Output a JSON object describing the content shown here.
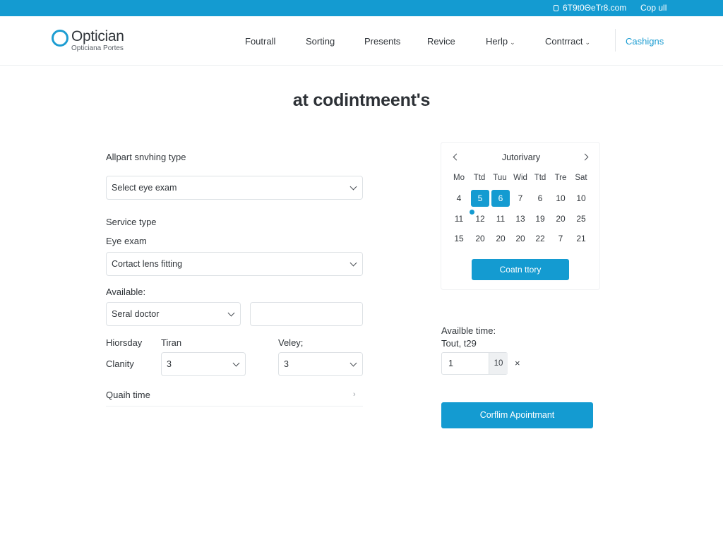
{
  "topbar": {
    "email": "6T9t0ΘeTr8.com",
    "login": "Cop ull"
  },
  "header": {
    "brand": "Optician",
    "tagline": "Opticiana Portes",
    "nav": [
      {
        "label": "Foutrall",
        "dropdown": false
      },
      {
        "label": "Sorting",
        "dropdown": false
      },
      {
        "label": "Presents",
        "dropdown": false
      },
      {
        "label": "Revice",
        "dropdown": false
      },
      {
        "label": "Herlp",
        "dropdown": true
      },
      {
        "label": "Contrract",
        "dropdown": true
      }
    ],
    "cta": "Cashigns"
  },
  "page_title": "at codintmeent's",
  "form": {
    "appointment_type_label": "Allpart snvhing type",
    "appointment_type_value": "Select eye exam",
    "service_type_label": "Service type",
    "service_sub_label": "Eye exam",
    "service_value": "Cortact lens fitting",
    "available_label": "Available:",
    "doctor_value": "Seral doctor",
    "weekday_label": "Hiorsday",
    "col1_label": "Tiran",
    "col2_label": "Veley;",
    "quantity_label": "Clanity",
    "col1_value": "3",
    "col2_value": "3",
    "quaih_time_label": "Quaih time",
    "row_arrow": "›"
  },
  "calendar": {
    "month": "Jutorivary",
    "weekdays": [
      "Mo",
      "Ttd",
      "Tuu",
      "Wid",
      "Ttd",
      "Tre",
      "Sat"
    ],
    "rows": [
      [
        "4",
        "5",
        "6",
        "7",
        "6",
        "10",
        "10"
      ],
      [
        "11",
        "12",
        "11",
        "13",
        "19",
        "20",
        "25"
      ],
      [
        "15",
        "20",
        "20",
        "20",
        "22",
        "7",
        "21"
      ]
    ],
    "button": "Coatn ttory"
  },
  "time": {
    "label": "Availble time:",
    "value": "Tout, t29",
    "qty": "1",
    "unit": "10",
    "close": "×"
  },
  "confirm_button": "Corflim Apointmant"
}
